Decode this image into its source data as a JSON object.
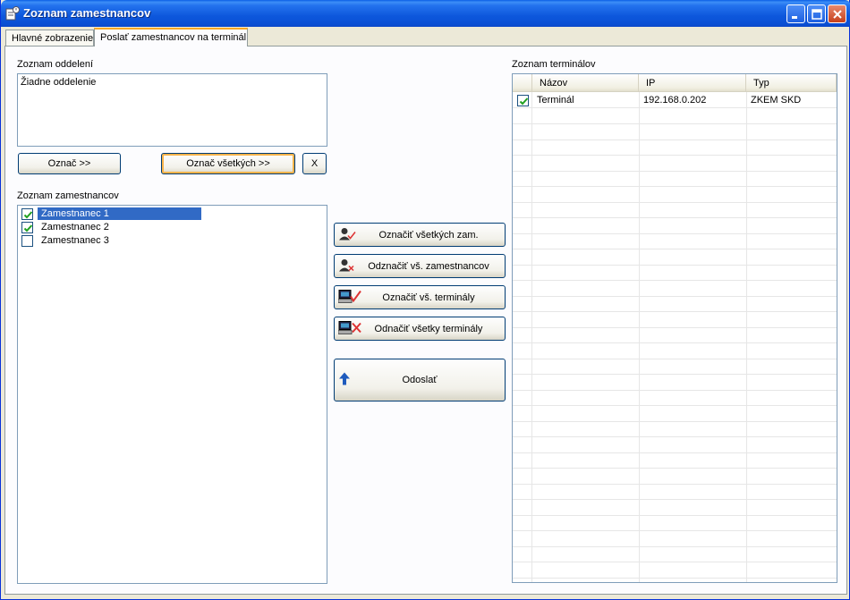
{
  "window": {
    "title": "Zoznam zamestnancov",
    "icons": {
      "app": "app-icon",
      "minimize": "minimize-icon",
      "maximize": "maximize-icon",
      "close": "close-icon"
    }
  },
  "tabs": [
    {
      "label": "Hlavné zobrazenie"
    },
    {
      "label": "Poslať zamestnancov na terminál",
      "active": true
    }
  ],
  "departments": {
    "label": "Zoznam oddelení",
    "items": [
      "Žiadne oddelenie"
    ],
    "select_button": "Označ >>",
    "select_all_button": "Označ všetkých >>",
    "clear_button": "X"
  },
  "employees": {
    "label": "Zoznam zamestnancov",
    "items": [
      {
        "name": "Zamestnanec 1",
        "checked": true,
        "selected": true
      },
      {
        "name": "Zamestnanec 2",
        "checked": true,
        "selected": false
      },
      {
        "name": "Zamestnanec 3",
        "checked": false,
        "selected": false
      }
    ]
  },
  "actions": {
    "check_all_employees": "Označiť všetkých zam.",
    "uncheck_all_employees": "Odznačiť vš. zamestnancov",
    "check_all_terminals": "Označiť vš. terminály",
    "uncheck_all_terminals": "Odnačiť všetky terminály",
    "send": "Odoslať"
  },
  "terminals": {
    "label": "Zoznam terminálov",
    "columns": [
      "Názov",
      "IP",
      "Typ"
    ],
    "rows": [
      {
        "checked": true,
        "name": "Terminál",
        "ip": "192.168.0.202",
        "type": "ZKEM SKD"
      }
    ]
  },
  "colors": {
    "title_bar": "#0a5fe6",
    "selection": "#316ac5",
    "tab_highlight": "#f7a826",
    "check": "#21a121"
  }
}
